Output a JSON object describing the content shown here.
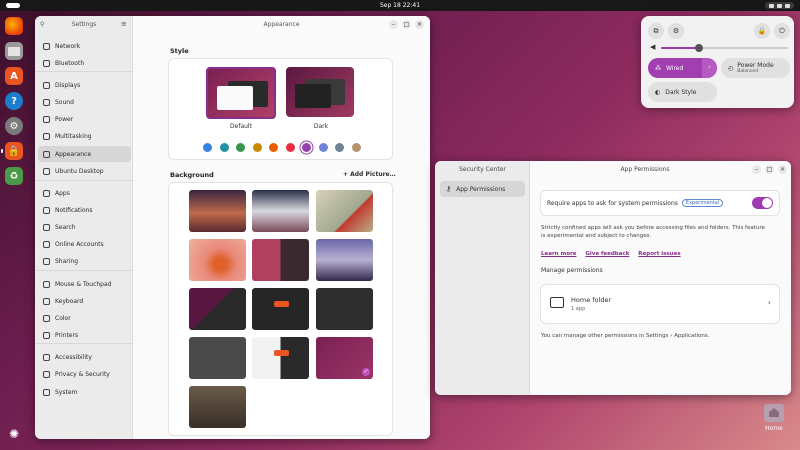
{
  "topbar": {
    "clock": "Sep 18  22:41"
  },
  "settings": {
    "sidebar_title": "Settings",
    "window_title": "Appearance",
    "sidebar": [
      {
        "label": "Network",
        "icon": "network-icon"
      },
      {
        "label": "Bluetooth",
        "icon": "bluetooth-icon"
      },
      {
        "label": "Displays",
        "icon": "display-icon"
      },
      {
        "label": "Sound",
        "icon": "speaker-icon"
      },
      {
        "label": "Power",
        "icon": "power-icon"
      },
      {
        "label": "Multitasking",
        "icon": "multitasking-icon"
      },
      {
        "label": "Appearance",
        "icon": "appearance-icon"
      },
      {
        "label": "Ubuntu Desktop",
        "icon": "desktop-icon"
      },
      {
        "label": "Apps",
        "icon": "apps-icon"
      },
      {
        "label": "Notifications",
        "icon": "bell-icon"
      },
      {
        "label": "Search",
        "icon": "search-icon"
      },
      {
        "label": "Online Accounts",
        "icon": "accounts-icon"
      },
      {
        "label": "Sharing",
        "icon": "share-icon"
      },
      {
        "label": "Mouse & Touchpad",
        "icon": "mouse-icon"
      },
      {
        "label": "Keyboard",
        "icon": "keyboard-icon"
      },
      {
        "label": "Color",
        "icon": "color-icon"
      },
      {
        "label": "Printers",
        "icon": "printer-icon"
      },
      {
        "label": "Accessibility",
        "icon": "accessibility-icon"
      },
      {
        "label": "Privacy & Security",
        "icon": "lock-icon"
      },
      {
        "label": "System",
        "icon": "gear-icon"
      }
    ],
    "style_heading": "Style",
    "style_default": "Default",
    "style_dark": "Dark",
    "accent_colors": [
      "#3584e4",
      "#2190a4",
      "#3a944a",
      "#c88800",
      "#ed5b00",
      "#e62d42",
      "#9141ac",
      "#6f83d6",
      "#6f8396",
      "#b8926b"
    ],
    "background_heading": "Background",
    "add_picture": "+ Add Picture…"
  },
  "security": {
    "sidebar_title": "Security Center",
    "window_title": "App Permissions",
    "nav_item": "App Permissions",
    "require_label": "Require apps to ask for system permissions",
    "badge": "Experimental",
    "description": "Strictly confined apps will ask you before accessing files and folders. This feature is experimental and subject to changes.",
    "links": [
      "Learn more",
      "Give feedback",
      "Report issues"
    ],
    "manage_heading": "Manage permissions",
    "home_folder": "Home folder",
    "home_sub": "1 app",
    "footer": "You can manage other permissions in Settings › Applications."
  },
  "quick_settings": {
    "volume_fraction": 0.3,
    "wired_label": "Wired",
    "power_label": "Power Mode",
    "power_value": "Balanced",
    "dark_style_label": "Dark Style"
  },
  "desktop": {
    "home_label": "Home"
  }
}
